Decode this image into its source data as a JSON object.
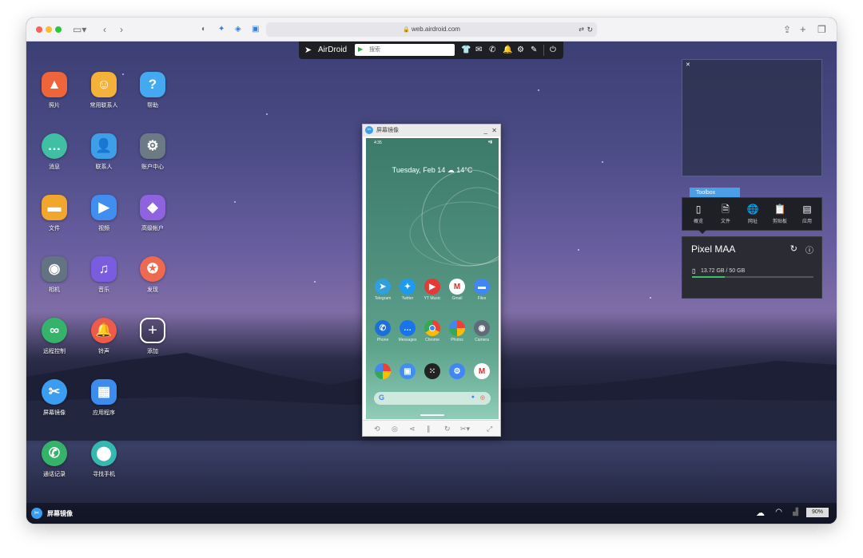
{
  "browser": {
    "url": "web.airdroid.com"
  },
  "toolbar": {
    "brand": "AirDroid",
    "search_placeholder": "搜索"
  },
  "desktop_apps": [
    {
      "label": "照片",
      "icon": "photo-icon",
      "color": "#f0643c"
    },
    {
      "label": "常用联系人",
      "icon": "favorite-contacts-icon",
      "color": "#f5b23a"
    },
    {
      "label": "帮助",
      "icon": "help-icon",
      "color": "#43a9f0"
    },
    {
      "label": "消息",
      "icon": "message-icon",
      "color": "#3fbfa3"
    },
    {
      "label": "联系人",
      "icon": "contacts-icon",
      "color": "#3f9ee8"
    },
    {
      "label": "账户中心",
      "icon": "gear-icon",
      "color": "#6c7a86"
    },
    {
      "label": "文件",
      "icon": "folder-icon",
      "color": "#f1a62d"
    },
    {
      "label": "视频",
      "icon": "video-icon",
      "color": "#3f8ef0"
    },
    {
      "label": "高级帐户",
      "icon": "diamond-icon",
      "color": "#8f63e0"
    },
    {
      "label": "相机",
      "icon": "camera-icon",
      "color": "#637381"
    },
    {
      "label": "音乐",
      "icon": "music-icon",
      "color": "#7a5ce0"
    },
    {
      "label": "发现",
      "icon": "planet-icon",
      "color": "#ee6a4f"
    },
    {
      "label": "远程控制",
      "icon": "binoculars-icon",
      "color": "#35b36a"
    },
    {
      "label": "铃声",
      "icon": "bell-icon",
      "color": "#ef5b4b"
    },
    {
      "label": "添加",
      "icon": "add-icon",
      "color": "transparent"
    },
    {
      "label": "屏幕镜像",
      "icon": "scissors-icon",
      "color": "#3a9df0"
    },
    {
      "label": "应用程序",
      "icon": "apps-icon",
      "color": "#3c8bed"
    },
    {
      "label": "通话记录",
      "icon": "phone-icon",
      "color": "#35b36a"
    },
    {
      "label": "寻找手机",
      "icon": "location-pin-icon",
      "color": "#34b8b0"
    }
  ],
  "mirror_window": {
    "title": "屏幕镜像",
    "status_time": "4:35",
    "date_weather": "Tuesday, Feb 14 ☁ 14°C",
    "apps_row1": [
      {
        "label": "Telegram",
        "color": "#2f9fe0"
      },
      {
        "label": "Twitter",
        "color": "#1d9bf0"
      },
      {
        "label": "YT Music",
        "color": "#e53935"
      },
      {
        "label": "Gmail",
        "color": "#ffffff"
      },
      {
        "label": "Files",
        "color": "#4285f4"
      }
    ],
    "apps_row2": [
      {
        "label": "Phone",
        "color": "#1f6fd9"
      },
      {
        "label": "Messages",
        "color": "#1a73e8"
      },
      {
        "label": "Chrome",
        "color": "#f0b400"
      },
      {
        "label": "Photos",
        "color": "#ffffff"
      },
      {
        "label": "Camera",
        "color": "#5f6b78"
      }
    ]
  },
  "toolbox": {
    "tab_label": "Toolbox",
    "items": [
      {
        "label": "概览",
        "icon": "phone-outline-icon"
      },
      {
        "label": "文件",
        "icon": "document-icon"
      },
      {
        "label": "网址",
        "icon": "globe-icon"
      },
      {
        "label": "剪贴板",
        "icon": "clipboard-icon"
      },
      {
        "label": "应用",
        "icon": "app-grid-icon"
      }
    ]
  },
  "device": {
    "name": "Pixel MAA",
    "storage": "13.72 GB / 50 GB",
    "storage_fraction": 0.27
  },
  "taskbar": {
    "active_app": "屏幕镜像",
    "battery": "90%"
  },
  "colors": {
    "accent": "#4b9fe6",
    "toolbar_bg": "#1e1f24"
  }
}
